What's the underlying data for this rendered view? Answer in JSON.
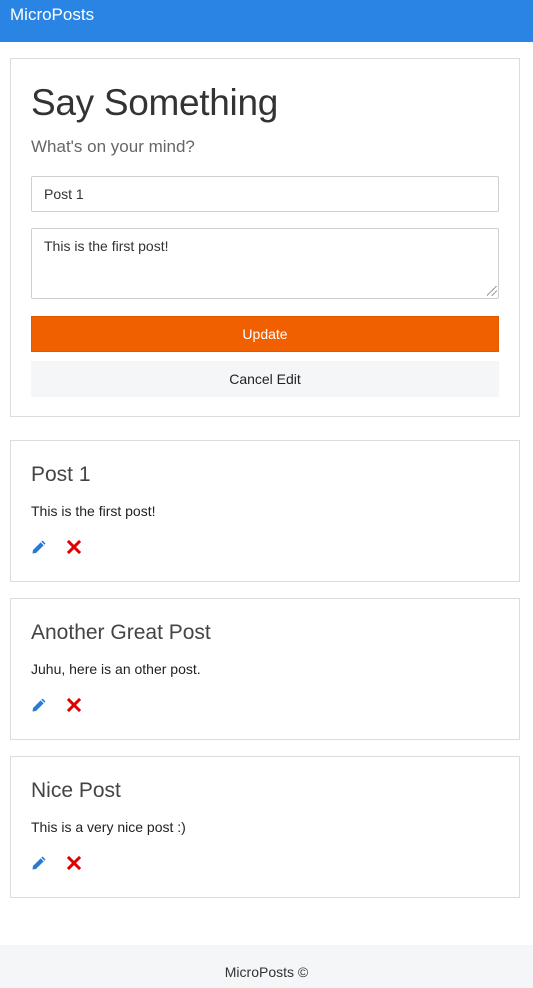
{
  "navbar": {
    "brand": "MicroPosts"
  },
  "form": {
    "title": "Say Something",
    "subtitle": "What's on your mind?",
    "title_input_value": "Post 1",
    "body_input_value": "This is the first post!",
    "update_label": "Update",
    "cancel_label": "Cancel Edit",
    "update_color": "#f06000"
  },
  "posts": [
    {
      "title": "Post 1",
      "body": "This is the first post!"
    },
    {
      "title": "Another Great Post",
      "body": "Juhu, here is an other post."
    },
    {
      "title": "Nice Post",
      "body": "This is a very nice post :)"
    }
  ],
  "icons": {
    "edit": "pencil-icon",
    "delete": "x-icon",
    "edit_color": "#2a7ad4",
    "delete_color": "#e00000"
  },
  "footer": {
    "text": "MicroPosts ©"
  }
}
